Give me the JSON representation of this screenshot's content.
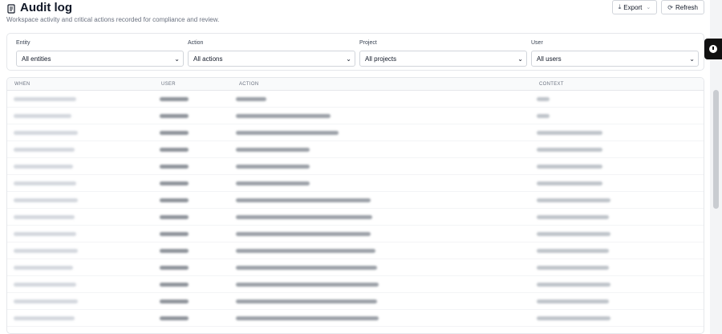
{
  "header": {
    "title": "Audit log",
    "subtitle": "Workspace activity and critical actions recorded for compliance and review.",
    "export_label": "Export",
    "refresh_label": "Refresh"
  },
  "filters": {
    "entity": {
      "label": "Entity",
      "value": "All entities"
    },
    "action": {
      "label": "Action",
      "value": "All actions"
    },
    "project": {
      "label": "Project",
      "value": "All projects"
    },
    "user": {
      "label": "User",
      "value": "All users"
    }
  },
  "table": {
    "headers": {
      "when": "WHEN",
      "user": "USER",
      "action": "ACTION",
      "context": "CONTEXT"
    },
    "row_count_visible": 14
  },
  "icons": {
    "title": "audit-log-icon",
    "export": "download-icon",
    "refresh": "refresh-icon",
    "fab": "clock-icon"
  }
}
